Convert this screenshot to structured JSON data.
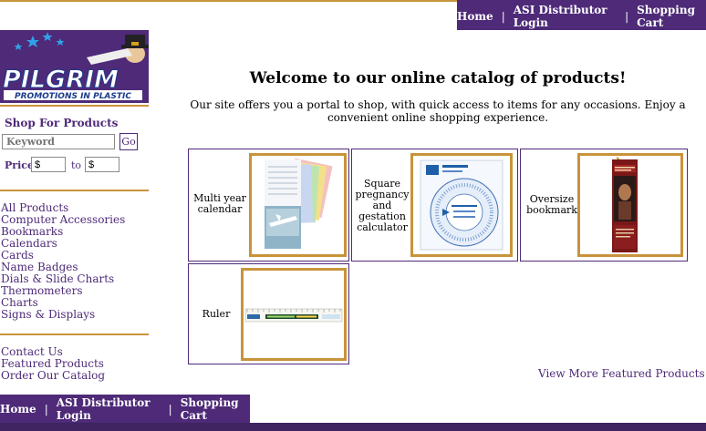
{
  "nav": {
    "home": "Home",
    "asi_login": "ASI Distributor Login",
    "cart": "Shopping Cart"
  },
  "logo": {
    "name": "PILGRIM",
    "tagline": "PROMOTIONS IN PLASTIC"
  },
  "sidebar": {
    "shop_title": "Shop For Products",
    "keyword_placeholder": "Keyword",
    "go_label": "Go",
    "price_label": "Price",
    "price_from": "$",
    "price_to_label": "to",
    "price_to": "$",
    "categories": [
      "All Products",
      "Computer Accessories",
      "Bookmarks",
      "Calendars",
      "Cards",
      "Name Badges",
      "Dials & Slide Charts",
      "Thermometers",
      "Charts",
      "Signs & Displays"
    ],
    "links": [
      "Contact Us",
      "Featured Products",
      "Order Our Catalog"
    ]
  },
  "main": {
    "welcome": "Welcome to our online catalog of products!",
    "intro": "Our site offers you a portal to shop, with quick access to items for any occasions. Enjoy a convenient online shopping experience.",
    "products": [
      {
        "name": "Multi year calendar"
      },
      {
        "name": "Square pregnancy and gestation calculator"
      },
      {
        "name": "Oversize bookmark"
      },
      {
        "name": "Ruler"
      }
    ],
    "view_more": "View More Featured Products"
  },
  "colors": {
    "brand_purple": "#4e2a78",
    "accent_gold": "#c8943a"
  }
}
